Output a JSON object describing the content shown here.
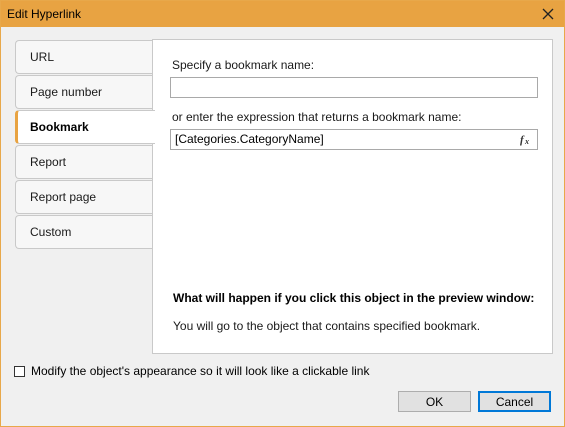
{
  "window": {
    "title": "Edit Hyperlink"
  },
  "tabs": [
    {
      "label": "URL",
      "active": false
    },
    {
      "label": "Page number",
      "active": false
    },
    {
      "label": "Bookmark",
      "active": true
    },
    {
      "label": "Report",
      "active": false
    },
    {
      "label": "Report page",
      "active": false
    },
    {
      "label": "Custom",
      "active": false
    }
  ],
  "bookmark": {
    "name_label": "Specify a bookmark name:",
    "name_value": "",
    "expression_label": "or enter the expression that returns a bookmark name:",
    "expression_value": "[Categories.CategoryName]",
    "fx_icon": "fx",
    "info_heading": "What will happen if you click this object in the preview window:",
    "info_text": "You will go to the object that contains specified bookmark."
  },
  "appearance_checkbox": {
    "label": "Modify the object's appearance so it will look like a clickable link",
    "checked": false
  },
  "buttons": {
    "ok": "OK",
    "cancel": "Cancel"
  },
  "colors": {
    "title_bar": "#e8a342",
    "default_button_border": "#0078d7"
  }
}
